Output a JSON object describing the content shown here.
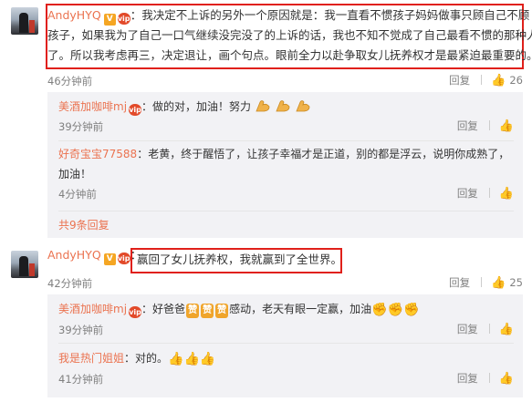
{
  "comment1": {
    "username": "AndyHYQ",
    "verified_badge": "V",
    "vip_badge": "vip",
    "text_lines": [
      "我决定不上诉的另外一个原因就是：我一直看不惯孩子妈妈做事只顾自己不顾",
      "孩子，如果我为了自己一口气继续没完没了的上诉的话，我也不知不觉成了自己最看不惯的那种人",
      "了。所以我考虑再三，决定退让，画个句点。眼前全力以赴争取女儿抚养权才是最紧迫最重要的。"
    ],
    "time": "46分钟前",
    "reply_label": "回复",
    "like_count": "26"
  },
  "replies1": [
    {
      "username": "美酒加咖啡mj",
      "text": "做的对，加油！努力",
      "emoji": "strong-arm",
      "time": "39分钟前",
      "reply_label": "回复"
    },
    {
      "username": "好奇宝宝77588",
      "text_lines": [
        "老黄，终于醒悟了，让孩子幸福才是正道，别的都是浮云，说明你成熟了，",
        "加油！"
      ],
      "time": "4分钟前",
      "reply_label": "回复"
    }
  ],
  "more_replies": "共9条回复",
  "comment2": {
    "username": "AndyHYQ",
    "verified_badge": "V",
    "vip_badge": "vip",
    "text": "赢回了女儿抚养权，我就赢到了全世界。",
    "time": "42分钟前",
    "reply_label": "回复",
    "like_count": "25"
  },
  "replies2": [
    {
      "username": "美酒加咖啡mj",
      "text_before": "好爸爸",
      "zan_label": "赞",
      "text_after": "感动，老天有眼一定赢，加油",
      "time": "39分钟前",
      "reply_label": "回复"
    },
    {
      "username": "我是热门姐姐",
      "text": "对的。",
      "time": "41分钟前",
      "reply_label": "回复"
    }
  ],
  "colors": {
    "username": "#eb7350",
    "highlight_box": "#e0201a",
    "reply_bg": "#f2f2f5"
  }
}
